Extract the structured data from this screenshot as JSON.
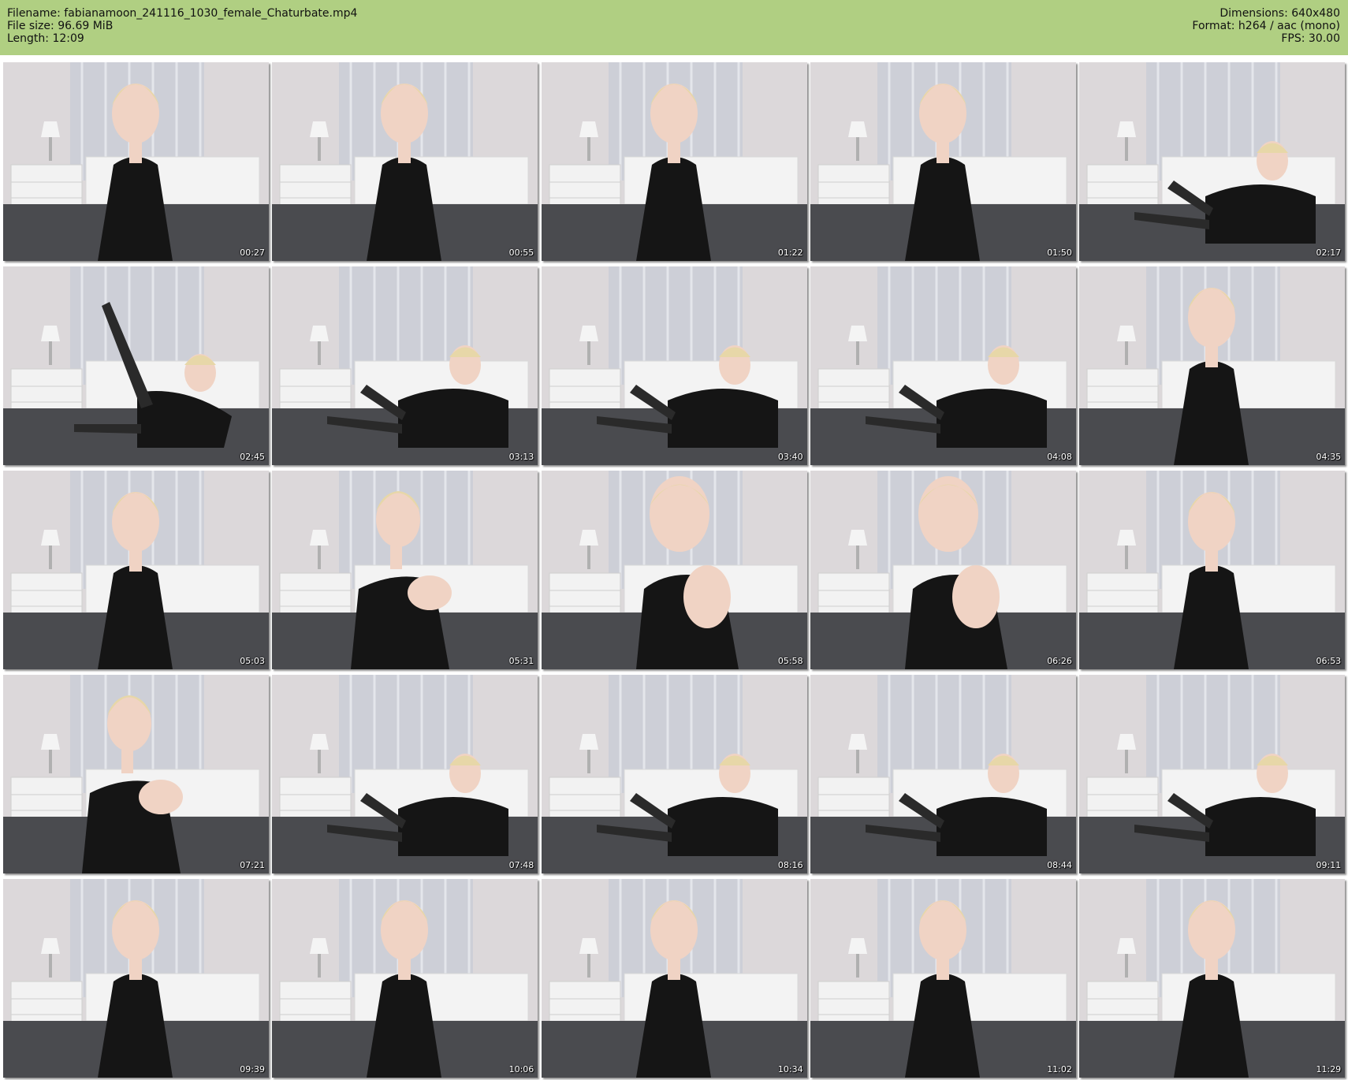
{
  "header": {
    "filename": "Filename: fabianamoon_241116_1030_female_Chaturbate.mp4",
    "filesize": "File size: 96.69 MiB",
    "length": "Length: 12:09",
    "dimensions": "Dimensions: 640x480",
    "format": "Format: h264 / aac (mono)",
    "fps": "FPS: 30.00"
  },
  "colors": {
    "header_bg": "#b0cf82",
    "dress": "#151515",
    "wall": "#dcd8da",
    "bed": "#4a4b4f"
  },
  "thumbnails": [
    {
      "time": "00:27",
      "pose": "sitting"
    },
    {
      "time": "00:55",
      "pose": "sitting"
    },
    {
      "time": "01:22",
      "pose": "sitting"
    },
    {
      "time": "01:50",
      "pose": "sitting"
    },
    {
      "time": "02:17",
      "pose": "lying"
    },
    {
      "time": "02:45",
      "pose": "leg-up"
    },
    {
      "time": "03:13",
      "pose": "lying"
    },
    {
      "time": "03:40",
      "pose": "lying"
    },
    {
      "time": "04:08",
      "pose": "lying"
    },
    {
      "time": "04:35",
      "pose": "sitting"
    },
    {
      "time": "05:03",
      "pose": "sitting"
    },
    {
      "time": "05:31",
      "pose": "shoulder"
    },
    {
      "time": "05:58",
      "pose": "closeup"
    },
    {
      "time": "06:26",
      "pose": "closeup"
    },
    {
      "time": "06:53",
      "pose": "sitting"
    },
    {
      "time": "07:21",
      "pose": "side"
    },
    {
      "time": "07:48",
      "pose": "lying"
    },
    {
      "time": "08:16",
      "pose": "lying"
    },
    {
      "time": "08:44",
      "pose": "lying"
    },
    {
      "time": "09:11",
      "pose": "lying"
    },
    {
      "time": "09:39",
      "pose": "sitting"
    },
    {
      "time": "10:06",
      "pose": "sitting"
    },
    {
      "time": "10:34",
      "pose": "sitting"
    },
    {
      "time": "11:02",
      "pose": "sitting"
    },
    {
      "time": "11:29",
      "pose": "sitting"
    }
  ]
}
